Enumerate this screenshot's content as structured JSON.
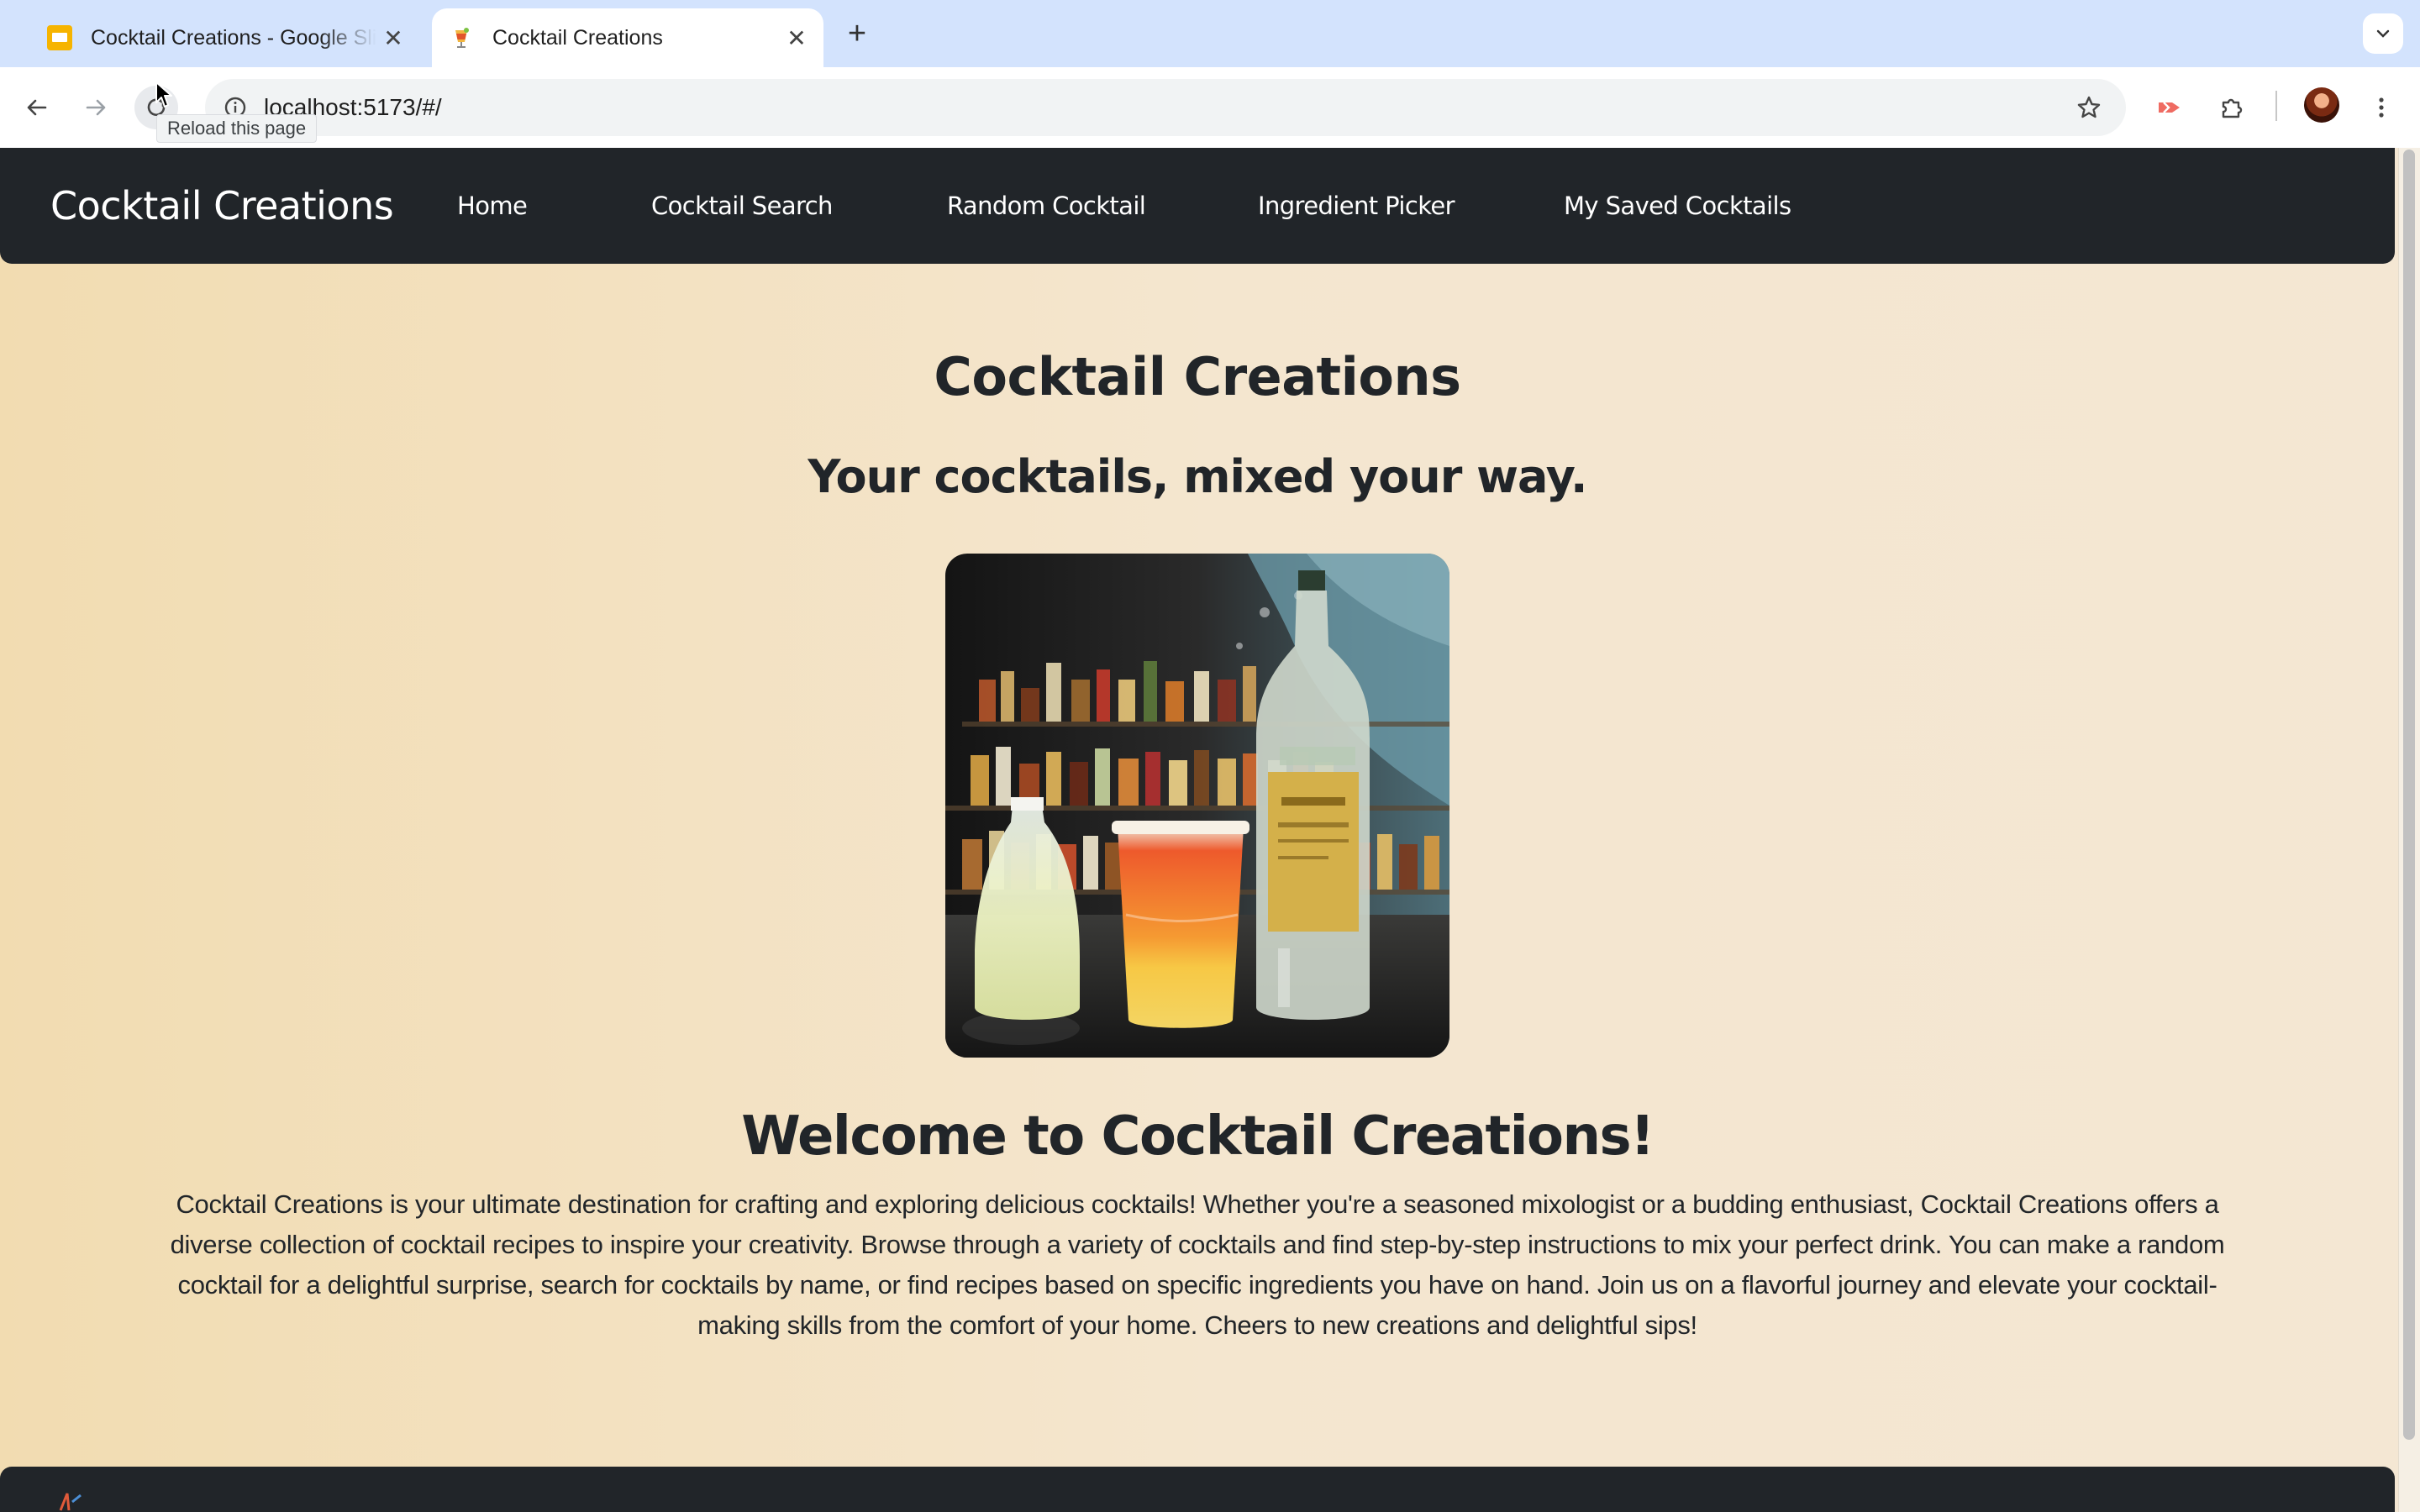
{
  "browser": {
    "tabs": [
      {
        "title": "Cocktail Creations - Google Slides",
        "icon": "google-slides-icon",
        "active": false
      },
      {
        "title": "Cocktail Creations",
        "icon": "cocktail-favicon",
        "active": true
      }
    ],
    "address": "localhost:5173/#/",
    "tooltip": "Reload this page"
  },
  "site": {
    "brand": "Cocktail Creations",
    "nav": [
      "Home",
      "Cocktail Search",
      "Random Cocktail",
      "Ingredient Picker",
      "My Saved Cocktails"
    ]
  },
  "hero": {
    "title": "Cocktail Creations",
    "tagline": "Your cocktails, mixed your way."
  },
  "welcome": {
    "heading": "Welcome to Cocktail Creations!",
    "body": "Cocktail Creations is your ultimate destination for crafting and exploring delicious cocktails! Whether you're a seasoned mixologist or a budding enthusiast, Cocktail Creations offers a diverse collection of cocktail recipes to inspire your creativity. Browse through a variety of cocktails and find step-by-step instructions to mix your perfect drink. You can make a random cocktail for a delightful surprise, search for cocktails by name, or find recipes based on specific ingredients you have on hand. Join us on a flavorful journey and elevate your cocktail-making skills from the comfort of your home. Cheers to new creations and delightful sips!"
  },
  "colors": {
    "nav_background": "#212529",
    "page_gradient_start": "#f2dcb1",
    "page_gradient_end": "#f4e7d3",
    "tabstrip": "#d3e3fd"
  }
}
